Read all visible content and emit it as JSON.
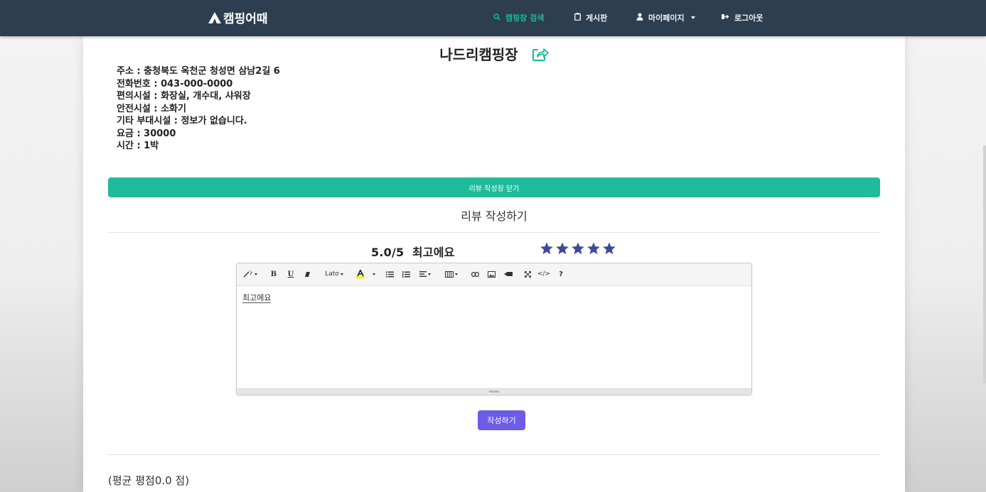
{
  "navbar": {
    "brand": "캠핑어때",
    "items": [
      {
        "label": "캠핑장 검색",
        "icon": "search-icon"
      },
      {
        "label": "게시판",
        "icon": "clipboard-icon"
      },
      {
        "label": "마이페이지",
        "icon": "user-icon"
      },
      {
        "label": "로그아웃",
        "icon": "logout-icon"
      }
    ]
  },
  "campsite": {
    "name": "나드리캠핑장",
    "info": [
      "주소 : 충청북도 옥천군 청성면 삼남2길 6",
      "전화번호 : 043-000-0000",
      "편의시설 : 화장실, 개수대, 샤워장",
      "안전시설 : 소화기",
      "기타 부대시설 : 정보가 없습니다.",
      "요금 : 30000",
      "시간 : 1박"
    ]
  },
  "review": {
    "close_button": "리뷰 작성창 닫기",
    "heading": "리뷰 작성하기",
    "score_text": "5.0/5",
    "rating_label": "최고에요",
    "stars_filled": 5,
    "stars_total": 5,
    "star_color": "#3f4a9b",
    "editor": {
      "font_name": "Lato",
      "content": "최고에요"
    },
    "submit_button": "작성하기",
    "average_text": "(평균 평점0.0 점)"
  },
  "colors": {
    "navbar": "#2c3e50",
    "accent": "#18bc9c",
    "submit": "#6c5ce7"
  }
}
